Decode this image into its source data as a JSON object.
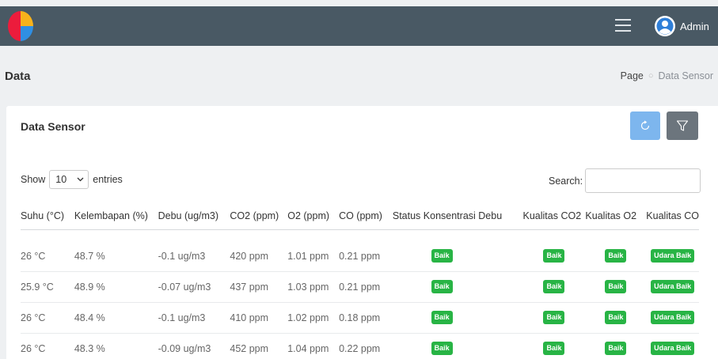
{
  "header": {
    "user_name": "Admin"
  },
  "page": {
    "title": "Data",
    "breadcrumb": [
      "Page",
      "Data Sensor"
    ]
  },
  "card": {
    "title": "Data Sensor"
  },
  "table_controls": {
    "show_label": "Show",
    "entries_value": "10",
    "entries_label": "entries",
    "search_label": "Search:",
    "search_value": ""
  },
  "table": {
    "columns": [
      "Suhu (°C)",
      "Kelembapan (%)",
      "Debu (ug/m3)",
      "CO2 (ppm)",
      "O2 (ppm)",
      "CO (ppm)",
      "Status Konsentrasi Debu",
      "Kualitas CO2",
      "Kualitas O2",
      "Kualitas CO"
    ],
    "rows": [
      [
        "26 °C",
        "48.7 %",
        "-0.1 ug/m3",
        "420 ppm",
        "1.01 ppm",
        "0.21 ppm",
        "Baik",
        "Baik",
        "Baik",
        "Udara Baik"
      ],
      [
        "25.9 °C",
        "48.9 %",
        "-0.07 ug/m3",
        "437 ppm",
        "1.03 ppm",
        "0.21 ppm",
        "Baik",
        "Baik",
        "Baik",
        "Udara Baik"
      ],
      [
        "26 °C",
        "48.4 %",
        "-0.1 ug/m3",
        "410 ppm",
        "1.02 ppm",
        "0.18 ppm",
        "Baik",
        "Baik",
        "Baik",
        "Udara Baik"
      ],
      [
        "26 °C",
        "48.3 %",
        "-0.09 ug/m3",
        "452 ppm",
        "1.04 ppm",
        "0.22 ppm",
        "Baik",
        "Baik",
        "Baik",
        "Udara Baik"
      ]
    ]
  },
  "icons": {
    "menu": "hamburger-icon",
    "avatar": "user-avatar-icon",
    "refresh": "refresh-icon",
    "filter": "filter-icon",
    "select": "chevron-down-icon"
  },
  "colors": {
    "topbar": "#495964",
    "badge": "#28b445",
    "refresh_button": "#7db6ee",
    "filter_button": "#6c757d"
  }
}
